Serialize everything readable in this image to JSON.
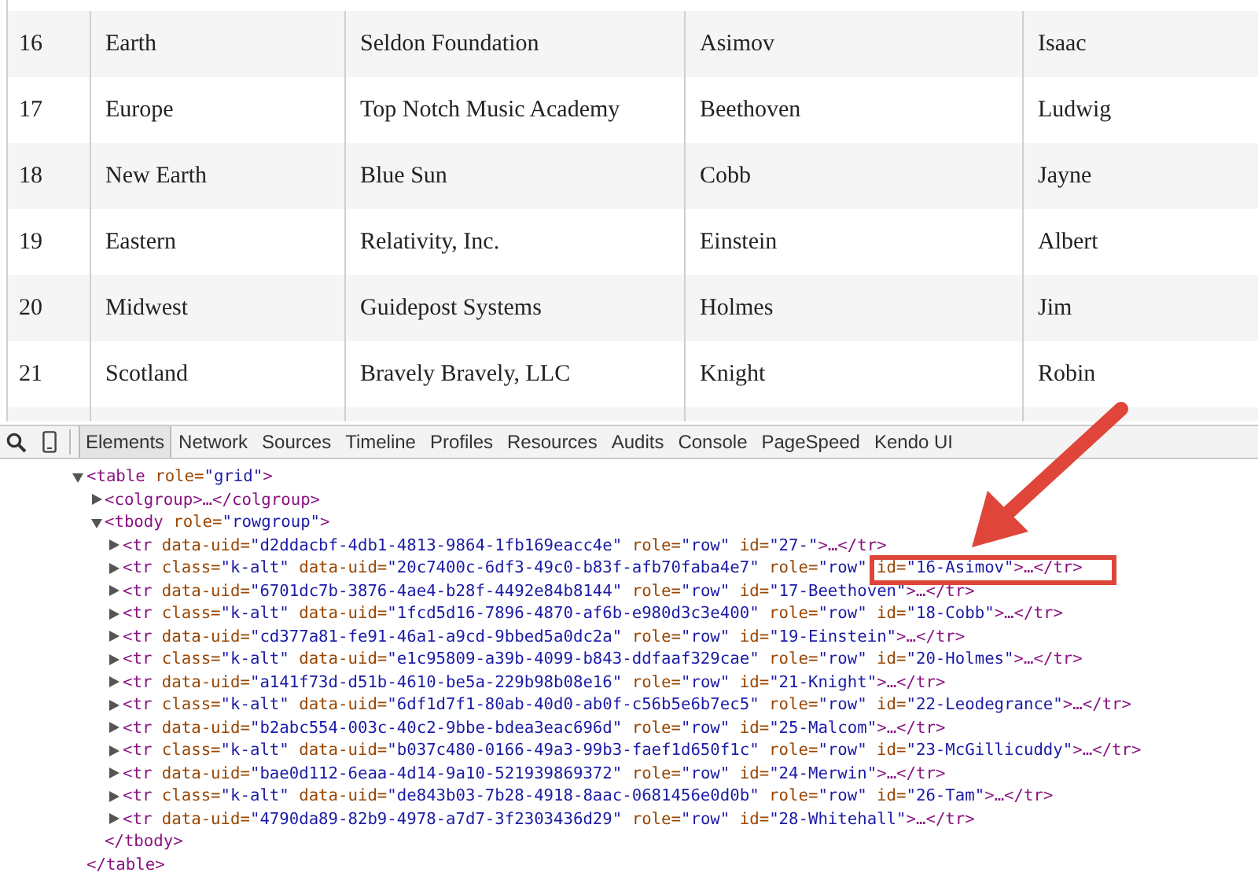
{
  "table": {
    "rows": [
      {
        "cells": [
          "16",
          "Earth",
          "Seldon Foundation",
          "Asimov",
          "Isaac"
        ]
      },
      {
        "cells": [
          "17",
          "Europe",
          "Top Notch Music Academy",
          "Beethoven",
          "Ludwig"
        ]
      },
      {
        "cells": [
          "18",
          "New Earth",
          "Blue Sun",
          "Cobb",
          "Jayne"
        ]
      },
      {
        "cells": [
          "19",
          "Eastern",
          "Relativity, Inc.",
          "Einstein",
          "Albert"
        ]
      },
      {
        "cells": [
          "20",
          "Midwest",
          "Guidepost Systems",
          "Holmes",
          "Jim"
        ]
      },
      {
        "cells": [
          "21",
          "Scotland",
          "Bravely Bravely, LLC",
          "Knight",
          "Robin"
        ]
      }
    ]
  },
  "devtools": {
    "tabs": [
      {
        "label": "Elements",
        "selected": true
      },
      {
        "label": "Network",
        "selected": false
      },
      {
        "label": "Sources",
        "selected": false
      },
      {
        "label": "Timeline",
        "selected": false
      },
      {
        "label": "Profiles",
        "selected": false
      },
      {
        "label": "Resources",
        "selected": false
      },
      {
        "label": "Audits",
        "selected": false
      },
      {
        "label": "Console",
        "selected": false
      },
      {
        "label": "PageSpeed",
        "selected": false
      },
      {
        "label": "Kendo UI",
        "selected": false
      }
    ],
    "dom_tree": [
      {
        "open_tag": "<table",
        "attributes": [
          {
            "name": " role=",
            "value": "\"grid\""
          }
        ],
        "open_end": ">",
        "close_tag": "</table>",
        "expanded": true,
        "children": [
          {
            "open_tag": "<colgroup",
            "open_end": ">",
            "ellipsis": "…",
            "close_tag": "</colgroup>",
            "expanded": false
          },
          {
            "open_tag": "<tbody",
            "attributes": [
              {
                "name": " role=",
                "value": "\"rowgroup\""
              }
            ],
            "open_end": ">",
            "close_tag": "</tbody>",
            "expanded": true,
            "children": [
              {
                "open_tag": "<tr",
                "attributes": [
                  {
                    "name": " data-uid=",
                    "value": "\"d2ddacbf-4db1-4813-9864-1fb169eacc4e\""
                  },
                  {
                    "name": " role=",
                    "value": "\"row\""
                  },
                  {
                    "name": " id=",
                    "value": "\"27-\""
                  }
                ],
                "open_end": ">",
                "ellipsis": "…",
                "close_tag": "</tr>",
                "expanded": false
              },
              {
                "open_tag": "<tr",
                "attributes": [
                  {
                    "name": " class=",
                    "value": "\"k-alt\""
                  },
                  {
                    "name": " data-uid=",
                    "value": "\"20c7400c-6df3-49c0-b83f-afb70faba4e7\""
                  },
                  {
                    "name": " role=",
                    "value": "\"row\""
                  },
                  {
                    "name": " id=",
                    "value": "\"16-Asimov\""
                  }
                ],
                "open_end": ">",
                "ellipsis": "…",
                "close_tag": "</tr>",
                "expanded": false
              },
              {
                "open_tag": "<tr",
                "attributes": [
                  {
                    "name": " data-uid=",
                    "value": "\"6701dc7b-3876-4ae4-b28f-4492e84b8144\""
                  },
                  {
                    "name": " role=",
                    "value": "\"row\""
                  },
                  {
                    "name": " id=",
                    "value": "\"17-Beethoven\""
                  }
                ],
                "open_end": ">",
                "ellipsis": "…",
                "close_tag": "</tr>",
                "expanded": false
              },
              {
                "open_tag": "<tr",
                "attributes": [
                  {
                    "name": " class=",
                    "value": "\"k-alt\""
                  },
                  {
                    "name": " data-uid=",
                    "value": "\"1fcd5d16-7896-4870-af6b-e980d3c3e400\""
                  },
                  {
                    "name": " role=",
                    "value": "\"row\""
                  },
                  {
                    "name": " id=",
                    "value": "\"18-Cobb\""
                  }
                ],
                "open_end": ">",
                "ellipsis": "…",
                "close_tag": "</tr>",
                "expanded": false
              },
              {
                "open_tag": "<tr",
                "attributes": [
                  {
                    "name": " data-uid=",
                    "value": "\"cd377a81-fe91-46a1-a9cd-9bbed5a0dc2a\""
                  },
                  {
                    "name": " role=",
                    "value": "\"row\""
                  },
                  {
                    "name": " id=",
                    "value": "\"19-Einstein\""
                  }
                ],
                "open_end": ">",
                "ellipsis": "…",
                "close_tag": "</tr>",
                "expanded": false
              },
              {
                "open_tag": "<tr",
                "attributes": [
                  {
                    "name": " class=",
                    "value": "\"k-alt\""
                  },
                  {
                    "name": " data-uid=",
                    "value": "\"e1c95809-a39b-4099-b843-ddfaaf329cae\""
                  },
                  {
                    "name": " role=",
                    "value": "\"row\""
                  },
                  {
                    "name": " id=",
                    "value": "\"20-Holmes\""
                  }
                ],
                "open_end": ">",
                "ellipsis": "…",
                "close_tag": "</tr>",
                "expanded": false
              },
              {
                "open_tag": "<tr",
                "attributes": [
                  {
                    "name": " data-uid=",
                    "value": "\"a141f73d-d51b-4610-be5a-229b98b08e16\""
                  },
                  {
                    "name": " role=",
                    "value": "\"row\""
                  },
                  {
                    "name": " id=",
                    "value": "\"21-Knight\""
                  }
                ],
                "open_end": ">",
                "ellipsis": "…",
                "close_tag": "</tr>",
                "expanded": false
              },
              {
                "open_tag": "<tr",
                "attributes": [
                  {
                    "name": " class=",
                    "value": "\"k-alt\""
                  },
                  {
                    "name": " data-uid=",
                    "value": "\"6df1d7f1-80ab-40d0-ab0f-c56b5e6b7ec5\""
                  },
                  {
                    "name": " role=",
                    "value": "\"row\""
                  },
                  {
                    "name": " id=",
                    "value": "\"22-Leodegrance\""
                  }
                ],
                "open_end": ">",
                "ellipsis": "…",
                "close_tag": "</tr>",
                "expanded": false
              },
              {
                "open_tag": "<tr",
                "attributes": [
                  {
                    "name": " data-uid=",
                    "value": "\"b2abc554-003c-40c2-9bbe-bdea3eac696d\""
                  },
                  {
                    "name": " role=",
                    "value": "\"row\""
                  },
                  {
                    "name": " id=",
                    "value": "\"25-Malcom\""
                  }
                ],
                "open_end": ">",
                "ellipsis": "…",
                "close_tag": "</tr>",
                "expanded": false
              },
              {
                "open_tag": "<tr",
                "attributes": [
                  {
                    "name": " class=",
                    "value": "\"k-alt\""
                  },
                  {
                    "name": " data-uid=",
                    "value": "\"b037c480-0166-49a3-99b3-faef1d650f1c\""
                  },
                  {
                    "name": " role=",
                    "value": "\"row\""
                  },
                  {
                    "name": " id=",
                    "value": "\"23-McGillicuddy\""
                  }
                ],
                "open_end": ">",
                "ellipsis": "…",
                "close_tag": "</tr>",
                "expanded": false
              },
              {
                "open_tag": "<tr",
                "attributes": [
                  {
                    "name": " data-uid=",
                    "value": "\"bae0d112-6eaa-4d14-9a10-521939869372\""
                  },
                  {
                    "name": " role=",
                    "value": "\"row\""
                  },
                  {
                    "name": " id=",
                    "value": "\"24-Merwin\""
                  }
                ],
                "open_end": ">",
                "ellipsis": "…",
                "close_tag": "</tr>",
                "expanded": false
              },
              {
                "open_tag": "<tr",
                "attributes": [
                  {
                    "name": " class=",
                    "value": "\"k-alt\""
                  },
                  {
                    "name": " data-uid=",
                    "value": "\"de843b03-7b28-4918-8aac-0681456e0d0b\""
                  },
                  {
                    "name": " role=",
                    "value": "\"row\""
                  },
                  {
                    "name": " id=",
                    "value": "\"26-Tam\""
                  }
                ],
                "open_end": ">",
                "ellipsis": "…",
                "close_tag": "</tr>",
                "expanded": false
              },
              {
                "open_tag": "<tr",
                "attributes": [
                  {
                    "name": " data-uid=",
                    "value": "\"4790da89-82b9-4978-a7d7-3f2303436d29\""
                  },
                  {
                    "name": " role=",
                    "value": "\"row\""
                  },
                  {
                    "name": " id=",
                    "value": "\"28-Whitehall\""
                  }
                ],
                "open_end": ">",
                "ellipsis": "…",
                "close_tag": "</tr>",
                "expanded": false
              }
            ]
          }
        ]
      }
    ]
  }
}
